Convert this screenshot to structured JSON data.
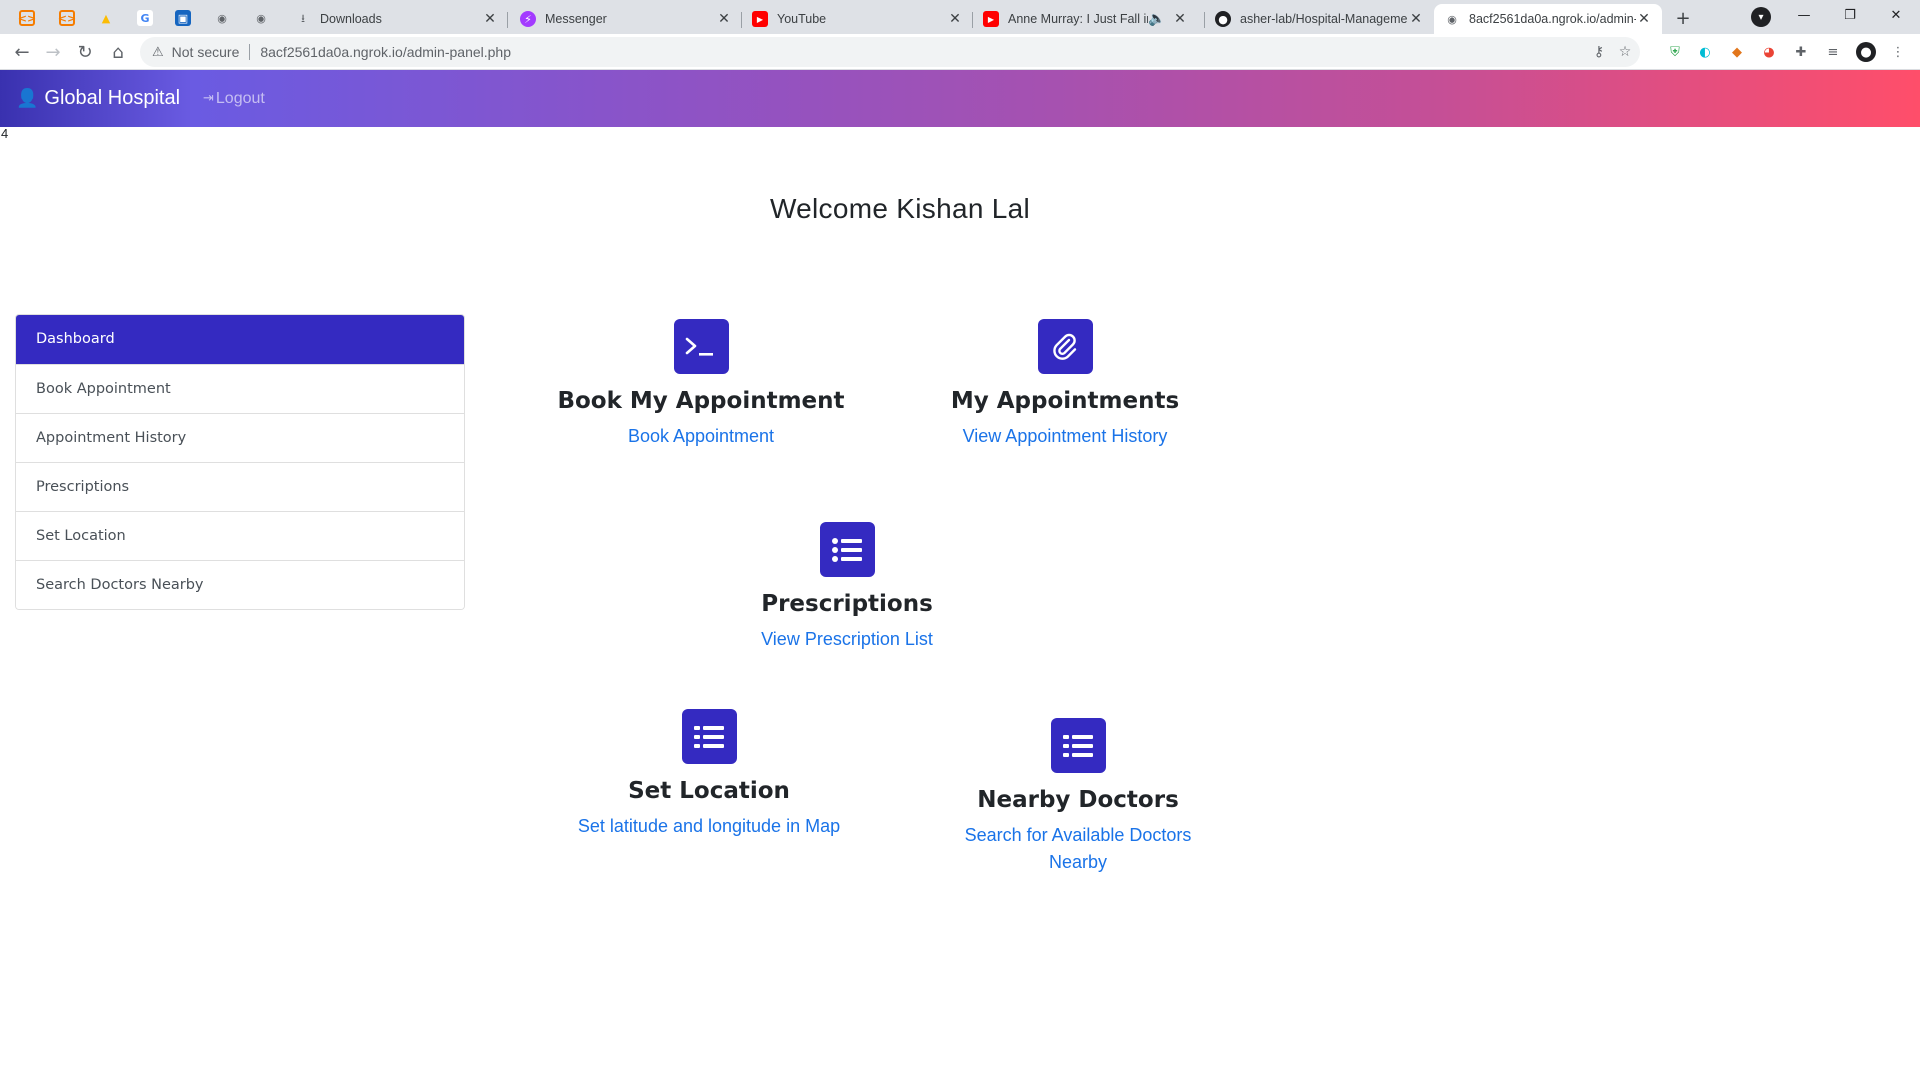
{
  "browser": {
    "tabs": [
      {
        "title": "Downloads",
        "icon": "download-icon"
      },
      {
        "title": "Messenger",
        "icon": "messenger-icon"
      },
      {
        "title": "YouTube",
        "icon": "youtube-icon"
      },
      {
        "title": "Anne Murray: I Just Fall in L",
        "icon": "youtube-icon"
      },
      {
        "title": "asher-lab/Hospital-Manageme",
        "icon": "github-icon"
      },
      {
        "title": "8acf2561da0a.ngrok.io/admin-",
        "icon": "globe-icon"
      }
    ],
    "address": {
      "security_label": "Not secure",
      "url_host": "8acf2561da0a.ngrok.io",
      "url_path": "/admin-panel.php"
    }
  },
  "site": {
    "brand": "Global Hospital",
    "logout_label": "Logout",
    "stray_text": "4",
    "welcome": "Welcome  Kishan Lal"
  },
  "sidebar": {
    "items": [
      {
        "label": "Dashboard",
        "active": true
      },
      {
        "label": "Book Appointment"
      },
      {
        "label": "Appointment History"
      },
      {
        "label": "Prescriptions"
      },
      {
        "label": "Set Location"
      },
      {
        "label": "Search Doctors Nearby"
      }
    ]
  },
  "cards": {
    "book": {
      "title": "Book My Appointment",
      "link": "Book Appointment",
      "icon": "terminal-icon"
    },
    "history": {
      "title": "My Appointments",
      "link": "View Appointment History",
      "icon": "paperclip-icon"
    },
    "prescriptions": {
      "title": "Prescriptions",
      "link": "View Prescription List",
      "icon": "list-icon"
    },
    "location": {
      "title": "Set Location",
      "link": "Set latitude and longitude in Map",
      "icon": "list-icon"
    },
    "doctors": {
      "title": "Nearby Doctors",
      "link": "Search for Available Doctors Nearby",
      "icon": "list-icon"
    }
  },
  "colors": {
    "accent": "#342ac1",
    "link": "#1a73e8",
    "nav_gradient_start": "#3931af",
    "nav_gradient_end": "#ff4e6a"
  }
}
